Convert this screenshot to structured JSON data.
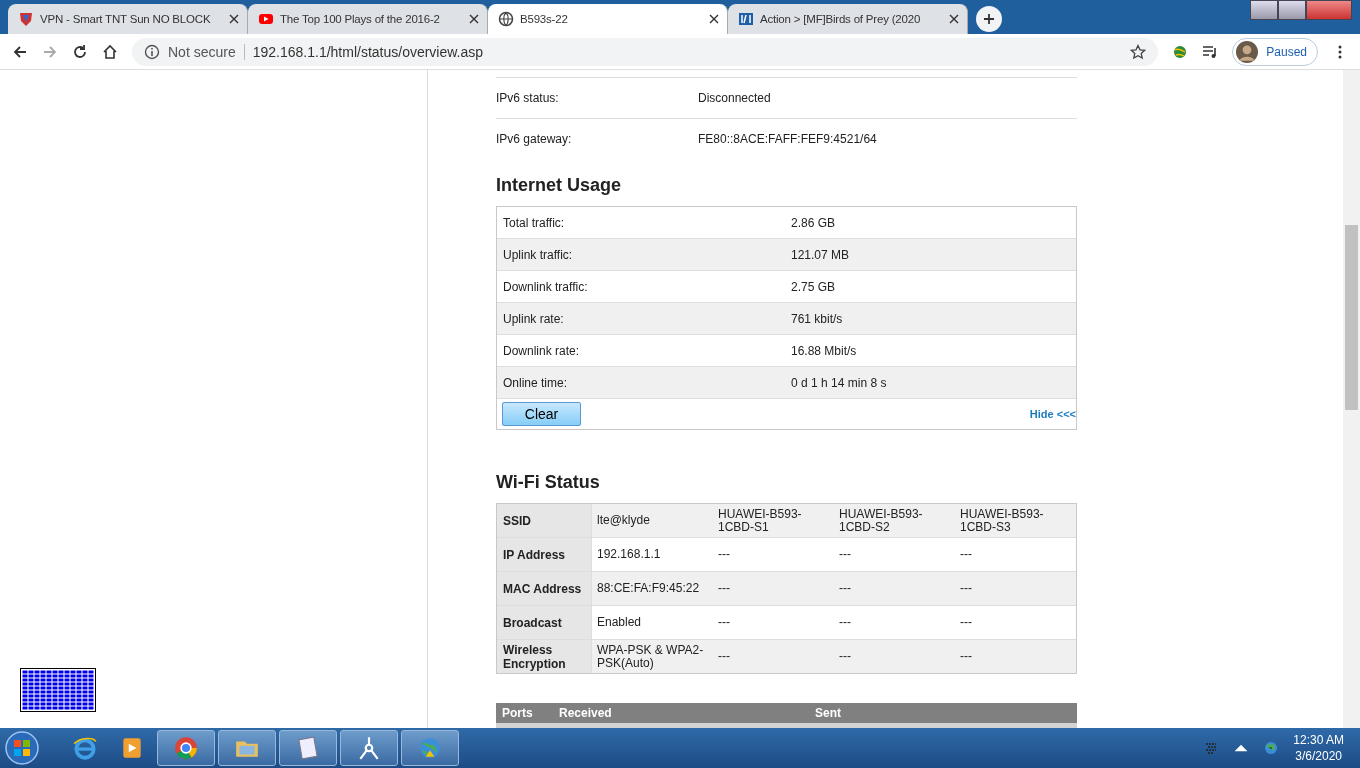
{
  "browser": {
    "tabs": [
      {
        "title": "VPN - Smart TNT Sun NO BLOCK",
        "selected": false,
        "kind": "shield"
      },
      {
        "title": "The Top 100 Plays of the 2016-2",
        "selected": false,
        "kind": "play"
      },
      {
        "title": "B593s-22",
        "selected": true,
        "kind": "globe"
      },
      {
        "title": "Action > [MF]Birds of Prey (2020",
        "selected": false,
        "kind": "film"
      }
    ],
    "security": "Not secure",
    "url": "192.168.1.1/html/status/overview.asp",
    "profile": "Paused"
  },
  "wan_rows": [
    {
      "label": "IPv6 status:",
      "value": "Disconnected"
    },
    {
      "label": "IPv6 gateway:",
      "value": "FE80::8ACE:FAFF:FEF9:4521/64"
    }
  ],
  "usage": {
    "title": "Internet Usage",
    "rows": [
      {
        "label": "Total traffic:",
        "value": "2.86 GB"
      },
      {
        "label": "Uplink traffic:",
        "value": "121.07 MB"
      },
      {
        "label": "Downlink traffic:",
        "value": "2.75 GB"
      },
      {
        "label": "Uplink rate:",
        "value": "761 kbit/s"
      },
      {
        "label": "Downlink rate:",
        "value": "16.88 Mbit/s"
      },
      {
        "label": "Online time:",
        "value": "0 d 1 h 14 min 8 s"
      }
    ],
    "clear_button": "Clear",
    "hide_link": "Hide <<<"
  },
  "wifi": {
    "title": "Wi-Fi Status",
    "rows": [
      {
        "label": "SSID",
        "values": [
          "lte@klyde",
          "HUAWEI-B593-1CBD-S1",
          "HUAWEI-B593-1CBD-S2",
          "HUAWEI-B593-1CBD-S3"
        ]
      },
      {
        "label": "IP Address",
        "values": [
          "192.168.1.1",
          "---",
          "---",
          "---"
        ]
      },
      {
        "label": "MAC Address",
        "values": [
          "88:CE:FA:F9:45:22",
          "---",
          "---",
          "---"
        ]
      },
      {
        "label": "Broadcast",
        "values": [
          "Enabled",
          "---",
          "---",
          "---"
        ]
      },
      {
        "label": "Wireless Encryption",
        "values": [
          "WPA-PSK & WPA2-PSK(Auto)",
          "---",
          "---",
          "---"
        ]
      }
    ]
  },
  "ports": {
    "headers": [
      "Ports",
      "Received",
      "Sent"
    ]
  },
  "taskbar": {
    "time": "12:30 AM",
    "date": "3/6/2020"
  }
}
